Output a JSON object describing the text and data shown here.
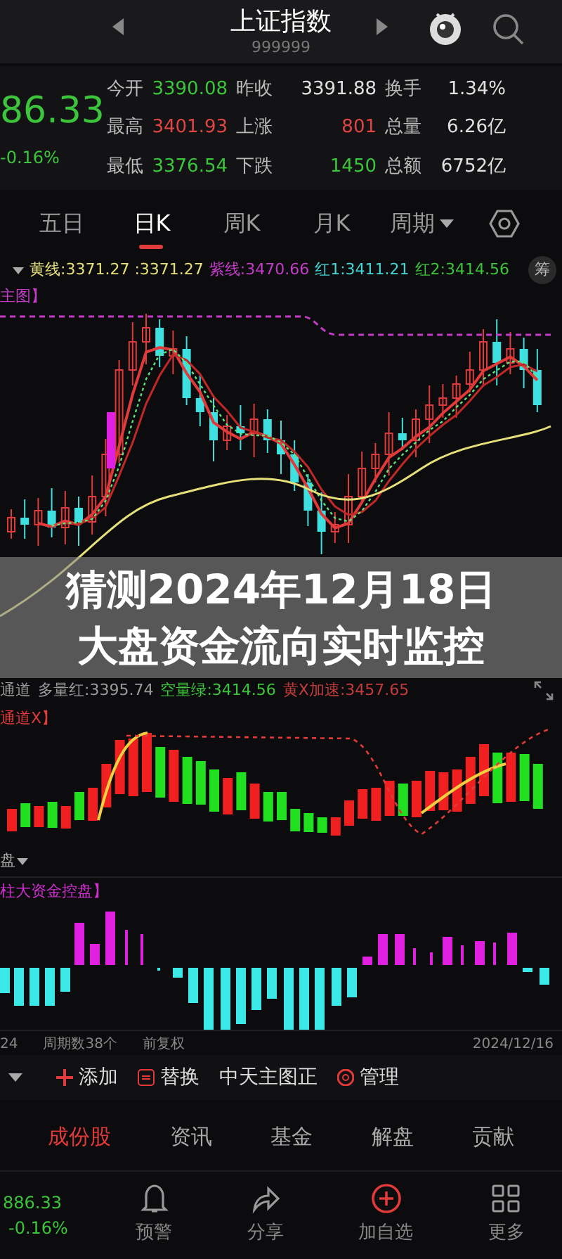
{
  "header": {
    "title": "上证指数",
    "code": "999999"
  },
  "quote": {
    "price": "86.33",
    "change": "-0.16%",
    "stats": [
      {
        "label": "今开",
        "value": "3390.08",
        "color": "#3cc43c"
      },
      {
        "label": "昨收",
        "value": "3391.88",
        "color": "#e0e0e0"
      },
      {
        "label": "换手",
        "value": "1.34%",
        "color": "#e0e0e0"
      },
      {
        "label": "最高",
        "value": "3401.93",
        "color": "#e04545"
      },
      {
        "label": "上涨",
        "value": "801",
        "color": "#e04545"
      },
      {
        "label": "总量",
        "value": "6.26亿",
        "color": "#e0e0e0"
      },
      {
        "label": "最低",
        "value": "3376.54",
        "color": "#3cc43c"
      },
      {
        "label": "下跌",
        "value": "1450",
        "color": "#3cc43c"
      },
      {
        "label": "总额",
        "value": "6752亿",
        "color": "#e0e0e0"
      }
    ]
  },
  "period_tabs": [
    {
      "label": "五日",
      "selected": false,
      "kind": "tab"
    },
    {
      "label": "日K",
      "selected": true,
      "kind": "tab"
    },
    {
      "label": "周K",
      "selected": false,
      "kind": "tab"
    },
    {
      "label": "月K",
      "selected": false,
      "kind": "tab"
    },
    {
      "label": "周期",
      "selected": false,
      "kind": "dropdown"
    }
  ],
  "main_chart": {
    "legend": [
      {
        "text": "黄线:3371.27 :3371.27",
        "color": "#e6e07a"
      },
      {
        "text": "紫线:3470.66",
        "color": "#c23cc8"
      },
      {
        "text": "红1:3411.21",
        "color": "#45d6d6"
      },
      {
        "text": "红2:3414.56",
        "color": "#3cc43c"
      }
    ],
    "badge": "筹",
    "title": "主图】"
  },
  "volume_chart": {
    "legend": [
      {
        "text": "通道",
        "color": "#9a9a9a"
      },
      {
        "text": "多量红:3395.74",
        "color": "#9a9a9a"
      },
      {
        "text": "空量绿:3414.56",
        "color": "#3cc43c"
      },
      {
        "text": "黄X加速:3457.65",
        "color": "#c23c3c"
      }
    ],
    "title": "通道X】"
  },
  "flow_chart": {
    "menu": "盘",
    "title": "柱大资金控盘】"
  },
  "footer": {
    "items": [
      "24",
      "周期数38个",
      "前复权"
    ],
    "date": "2024/12/16"
  },
  "toolbar": [
    {
      "kind": "add",
      "label": "添加"
    },
    {
      "kind": "swap",
      "label": "替换"
    },
    {
      "kind": "plain",
      "label": "中天主图正"
    },
    {
      "kind": "manage",
      "label": "管理"
    }
  ],
  "section_tabs": [
    {
      "label": "成份股",
      "selected": true
    },
    {
      "label": "资讯",
      "selected": false
    },
    {
      "label": "基金",
      "selected": false
    },
    {
      "label": "解盘",
      "selected": false
    },
    {
      "label": "贡献",
      "selected": false
    }
  ],
  "bottom_bar": {
    "price": "886.33",
    "change": "-0.16%",
    "actions": [
      {
        "kind": "bell",
        "label": "预警"
      },
      {
        "kind": "share",
        "label": "分享"
      },
      {
        "kind": "add",
        "label": "加自选"
      },
      {
        "kind": "more",
        "label": "更多"
      }
    ]
  },
  "overlay_title": [
    "猜测2024年12月18日",
    "大盘资金流向实时监控"
  ]
}
